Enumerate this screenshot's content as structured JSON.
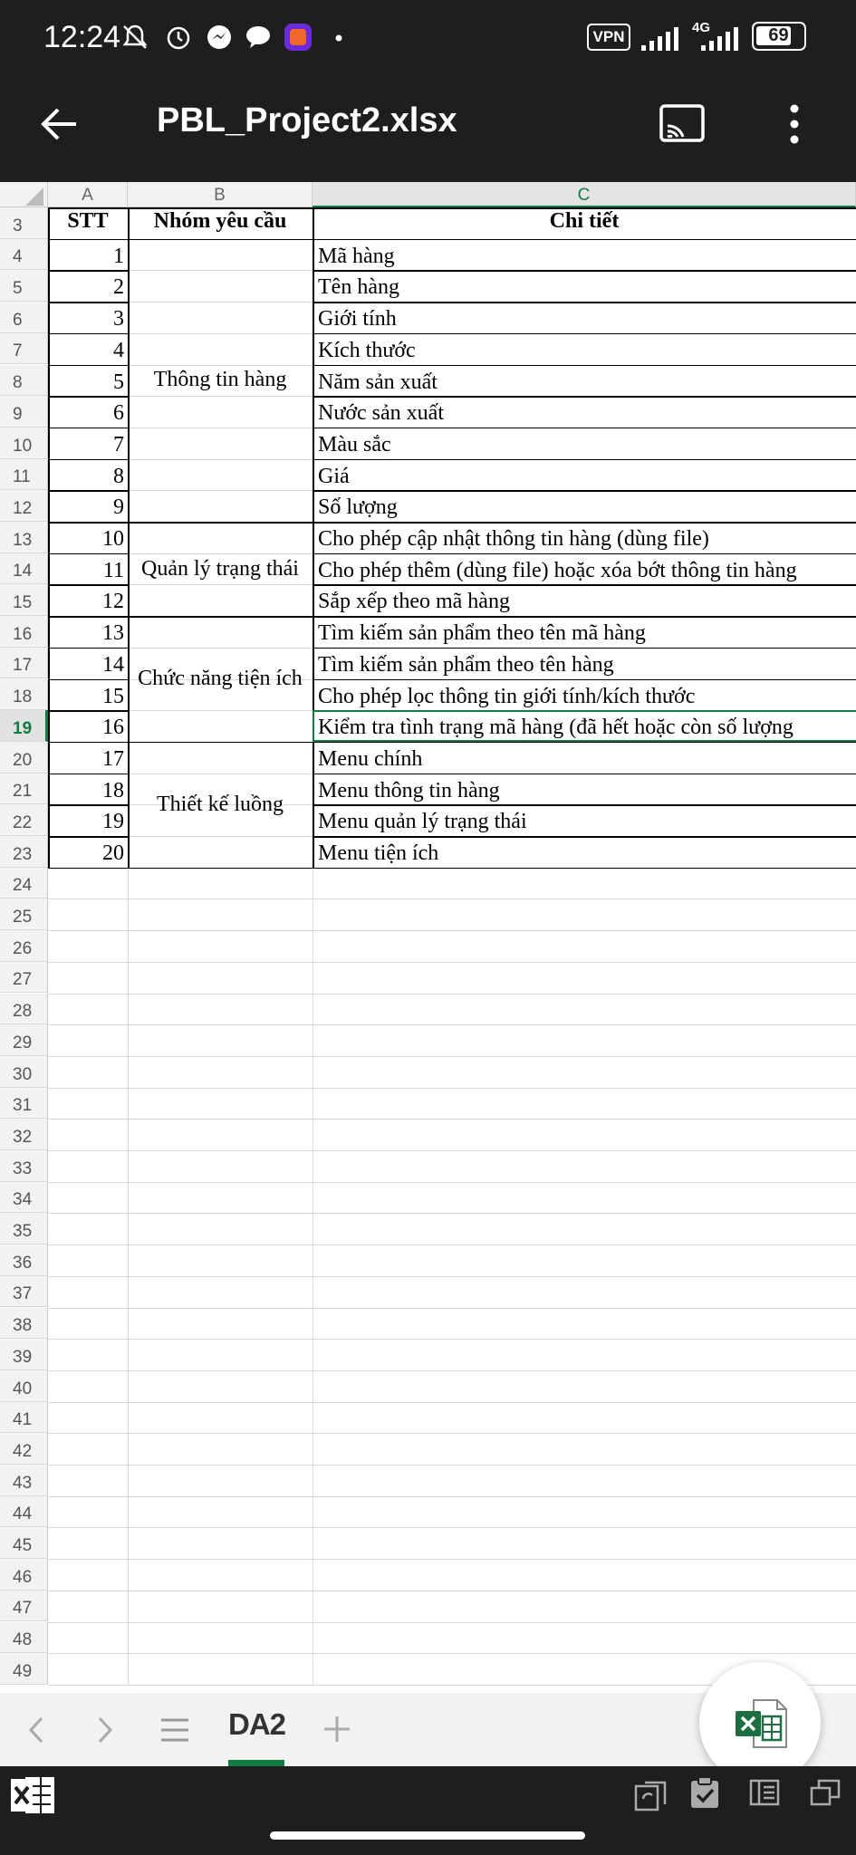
{
  "status": {
    "time": "12:24",
    "vpn": "VPN",
    "network": "4G",
    "battery": "69"
  },
  "app": {
    "title": "PBL_Project2.xlsx"
  },
  "columns": [
    "A",
    "B",
    "C"
  ],
  "header": {
    "stt": "STT",
    "group": "Nhóm yêu cầu",
    "detail": "Chi tiết"
  },
  "rows": [
    {
      "stt": "1",
      "detail": "Mã hàng"
    },
    {
      "stt": "2",
      "detail": "Tên hàng"
    },
    {
      "stt": "3",
      "detail": "Giới tính"
    },
    {
      "stt": "4",
      "detail": "Kích thước"
    },
    {
      "stt": "5",
      "detail": "Năm sản xuất"
    },
    {
      "stt": "6",
      "detail": "Nước sản xuất"
    },
    {
      "stt": "7",
      "detail": "Màu sắc"
    },
    {
      "stt": "8",
      "detail": "Giá"
    },
    {
      "stt": "9",
      "detail": "Số lượng"
    },
    {
      "stt": "10",
      "detail": "Cho phép cập nhật thông tin hàng (dùng file)"
    },
    {
      "stt": "11",
      "detail": "Cho phép thêm (dùng file) hoặc xóa bớt thông tin hàng"
    },
    {
      "stt": "12",
      "detail": "Sắp xếp theo mã hàng"
    },
    {
      "stt": "13",
      "detail": "Tìm kiếm sản phẩm theo tên mã hàng"
    },
    {
      "stt": "14",
      "detail": "Tìm kiếm sản phẩm theo tên hàng"
    },
    {
      "stt": "15",
      "detail": "Cho phép lọc thông tin giới tính/kích thước"
    },
    {
      "stt": "16",
      "detail": "Kiểm tra tình trạng mã hàng (đã hết hoặc còn số lượng"
    },
    {
      "stt": "17",
      "detail": "Menu chính"
    },
    {
      "stt": "18",
      "detail": "Menu thông tin hàng"
    },
    {
      "stt": "19",
      "detail": "Menu quản lý trạng thái"
    },
    {
      "stt": "20",
      "detail": "Menu tiện ích"
    }
  ],
  "groups": [
    {
      "label": "Thông tin hàng",
      "start": 0,
      "end": 8
    },
    {
      "label": "Quản lý trạng thái",
      "start": 9,
      "end": 11
    },
    {
      "label": "Chức năng tiện ích",
      "start": 12,
      "end": 15
    },
    {
      "label": "Thiết kế luồng",
      "start": 16,
      "end": 19
    }
  ],
  "row_numbers": [
    "3",
    "4",
    "5",
    "6",
    "7",
    "8",
    "9",
    "10",
    "11",
    "12",
    "13",
    "14",
    "15",
    "16",
    "17",
    "18",
    "19",
    "20",
    "21",
    "22",
    "23",
    "24",
    "25",
    "26",
    "27",
    "28",
    "29",
    "30",
    "31",
    "32",
    "33",
    "34",
    "35",
    "36",
    "37",
    "38",
    "39",
    "40",
    "41",
    "42",
    "43",
    "44",
    "45",
    "46",
    "47",
    "48",
    "49"
  ],
  "selected_row": "19",
  "tabs": {
    "active": "DA2"
  },
  "colors": {
    "accent": "#107c41",
    "excel": "#1d6f42"
  },
  "icons": [
    "back-arrow-icon",
    "cast-icon",
    "more-vert-icon",
    "prev-sheet-icon",
    "next-sheet-icon",
    "sheet-list-icon",
    "add-sheet-icon",
    "excel-icon"
  ]
}
